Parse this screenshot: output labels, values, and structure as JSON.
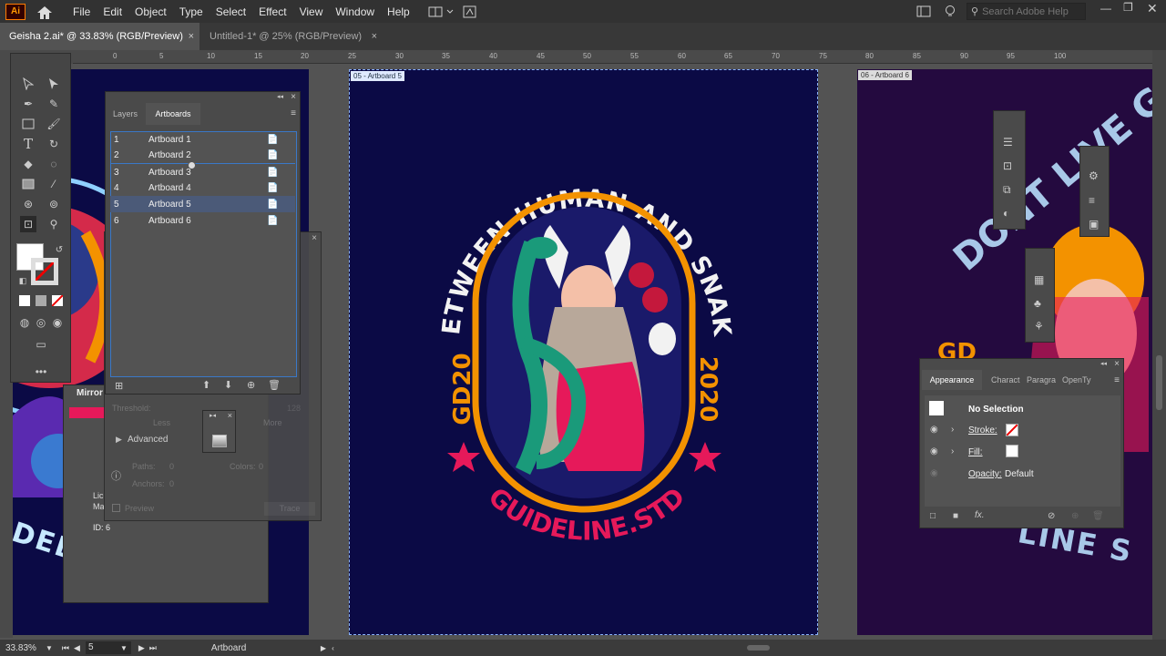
{
  "app": {
    "logo": "Ai"
  },
  "menu": [
    "File",
    "Edit",
    "Object",
    "Type",
    "Select",
    "Effect",
    "View",
    "Window",
    "Help"
  ],
  "search": {
    "placeholder": "Search Adobe Help"
  },
  "tabs": [
    {
      "label": "Geisha 2.ai* @ 33.83% (RGB/Preview)"
    },
    {
      "label": "Untitled-1* @ 25% (RGB/Preview)"
    }
  ],
  "ruler": [
    "0",
    "5",
    "10",
    "15",
    "20",
    "25",
    "30",
    "35",
    "40",
    "45",
    "50",
    "55",
    "60",
    "65",
    "70",
    "75",
    "80",
    "85",
    "90",
    "95",
    "100"
  ],
  "artboards_panel": {
    "tab_layers": "Layers",
    "tab_artboards": "Artboards",
    "items": [
      {
        "num": "1",
        "name": "Artboard 1"
      },
      {
        "num": "2",
        "name": "Artboard 2"
      },
      {
        "num": "3",
        "name": "Artboard 3"
      },
      {
        "num": "4",
        "name": "Artboard 4"
      },
      {
        "num": "5",
        "name": "Artboard 5"
      },
      {
        "num": "6",
        "name": "Artboard 6"
      }
    ]
  },
  "trace_panel": {
    "threshold": "Threshold:",
    "threshold_val": "128",
    "less": "Less",
    "more": "More",
    "advanced": "Advanced",
    "paths": "Paths:",
    "paths_val": "0",
    "colors": "Colors:",
    "colors_val": "0",
    "anchors": "Anchors:",
    "anchors_val": "0",
    "preview": "Preview",
    "trace": "Trace"
  },
  "mirror_panel": {
    "title": "Mirror",
    "lic": "Lic",
    "ma": "Ma",
    "id": "ID: 6"
  },
  "artboard_labels": {
    "ab5": "05 - Artboard 5",
    "ab6": "06 - Artboard 6"
  },
  "artwork": {
    "arc_text": "BETWEEN HUMAN AND SNAKE",
    "left_text": "GD20",
    "right_text": "2020",
    "bottom_text": "GUIDELINE.STD",
    "ab6_text": "DONT LIVE G",
    "ab6_gd": "GD",
    "ab6_bottom": "LINE S",
    "ab3_text": "DELINE"
  },
  "appearance": {
    "tab": "Appearance",
    "tab2": "Charact",
    "tab3": "Paragra",
    "tab4": "OpenTy",
    "selection": "No Selection",
    "stroke": "Stroke:",
    "fill": "Fill:",
    "opacity": "Opacity:",
    "opacity_val": "Default"
  },
  "status": {
    "zoom": "33.83%",
    "page": "5",
    "mode": "Artboard"
  },
  "colors": {
    "artboard_bg": "#0b0a45",
    "orange": "#f39200",
    "pink": "#e6195a",
    "white": "#f2f2f2",
    "ab6_bg": "#240a3f"
  }
}
